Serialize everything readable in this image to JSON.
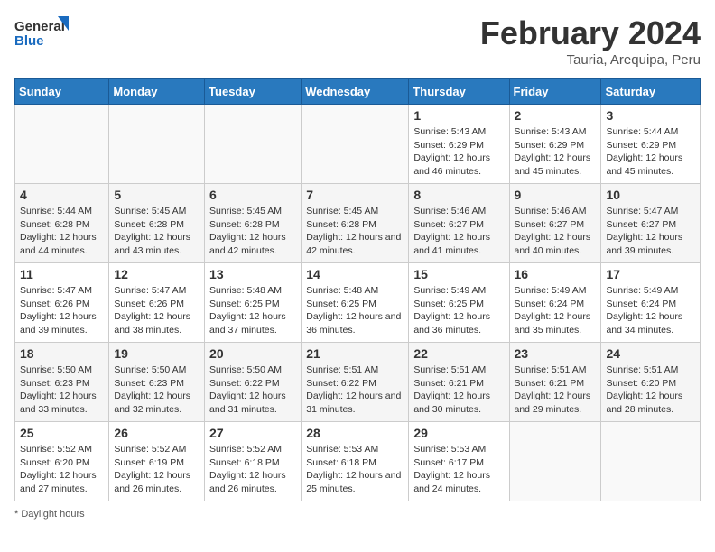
{
  "header": {
    "logo_general": "General",
    "logo_blue": "Blue",
    "main_title": "February 2024",
    "sub_title": "Tauria, Arequipa, Peru"
  },
  "days_of_week": [
    "Sunday",
    "Monday",
    "Tuesday",
    "Wednesday",
    "Thursday",
    "Friday",
    "Saturday"
  ],
  "weeks": [
    [
      {
        "day": "",
        "info": ""
      },
      {
        "day": "",
        "info": ""
      },
      {
        "day": "",
        "info": ""
      },
      {
        "day": "",
        "info": ""
      },
      {
        "day": "1",
        "info": "Sunrise: 5:43 AM\nSunset: 6:29 PM\nDaylight: 12 hours and 46 minutes."
      },
      {
        "day": "2",
        "info": "Sunrise: 5:43 AM\nSunset: 6:29 PM\nDaylight: 12 hours and 45 minutes."
      },
      {
        "day": "3",
        "info": "Sunrise: 5:44 AM\nSunset: 6:29 PM\nDaylight: 12 hours and 45 minutes."
      }
    ],
    [
      {
        "day": "4",
        "info": "Sunrise: 5:44 AM\nSunset: 6:28 PM\nDaylight: 12 hours and 44 minutes."
      },
      {
        "day": "5",
        "info": "Sunrise: 5:45 AM\nSunset: 6:28 PM\nDaylight: 12 hours and 43 minutes."
      },
      {
        "day": "6",
        "info": "Sunrise: 5:45 AM\nSunset: 6:28 PM\nDaylight: 12 hours and 42 minutes."
      },
      {
        "day": "7",
        "info": "Sunrise: 5:45 AM\nSunset: 6:28 PM\nDaylight: 12 hours and 42 minutes."
      },
      {
        "day": "8",
        "info": "Sunrise: 5:46 AM\nSunset: 6:27 PM\nDaylight: 12 hours and 41 minutes."
      },
      {
        "day": "9",
        "info": "Sunrise: 5:46 AM\nSunset: 6:27 PM\nDaylight: 12 hours and 40 minutes."
      },
      {
        "day": "10",
        "info": "Sunrise: 5:47 AM\nSunset: 6:27 PM\nDaylight: 12 hours and 39 minutes."
      }
    ],
    [
      {
        "day": "11",
        "info": "Sunrise: 5:47 AM\nSunset: 6:26 PM\nDaylight: 12 hours and 39 minutes."
      },
      {
        "day": "12",
        "info": "Sunrise: 5:47 AM\nSunset: 6:26 PM\nDaylight: 12 hours and 38 minutes."
      },
      {
        "day": "13",
        "info": "Sunrise: 5:48 AM\nSunset: 6:25 PM\nDaylight: 12 hours and 37 minutes."
      },
      {
        "day": "14",
        "info": "Sunrise: 5:48 AM\nSunset: 6:25 PM\nDaylight: 12 hours and 36 minutes."
      },
      {
        "day": "15",
        "info": "Sunrise: 5:49 AM\nSunset: 6:25 PM\nDaylight: 12 hours and 36 minutes."
      },
      {
        "day": "16",
        "info": "Sunrise: 5:49 AM\nSunset: 6:24 PM\nDaylight: 12 hours and 35 minutes."
      },
      {
        "day": "17",
        "info": "Sunrise: 5:49 AM\nSunset: 6:24 PM\nDaylight: 12 hours and 34 minutes."
      }
    ],
    [
      {
        "day": "18",
        "info": "Sunrise: 5:50 AM\nSunset: 6:23 PM\nDaylight: 12 hours and 33 minutes."
      },
      {
        "day": "19",
        "info": "Sunrise: 5:50 AM\nSunset: 6:23 PM\nDaylight: 12 hours and 32 minutes."
      },
      {
        "day": "20",
        "info": "Sunrise: 5:50 AM\nSunset: 6:22 PM\nDaylight: 12 hours and 31 minutes."
      },
      {
        "day": "21",
        "info": "Sunrise: 5:51 AM\nSunset: 6:22 PM\nDaylight: 12 hours and 31 minutes."
      },
      {
        "day": "22",
        "info": "Sunrise: 5:51 AM\nSunset: 6:21 PM\nDaylight: 12 hours and 30 minutes."
      },
      {
        "day": "23",
        "info": "Sunrise: 5:51 AM\nSunset: 6:21 PM\nDaylight: 12 hours and 29 minutes."
      },
      {
        "day": "24",
        "info": "Sunrise: 5:51 AM\nSunset: 6:20 PM\nDaylight: 12 hours and 28 minutes."
      }
    ],
    [
      {
        "day": "25",
        "info": "Sunrise: 5:52 AM\nSunset: 6:20 PM\nDaylight: 12 hours and 27 minutes."
      },
      {
        "day": "26",
        "info": "Sunrise: 5:52 AM\nSunset: 6:19 PM\nDaylight: 12 hours and 26 minutes."
      },
      {
        "day": "27",
        "info": "Sunrise: 5:52 AM\nSunset: 6:18 PM\nDaylight: 12 hours and 26 minutes."
      },
      {
        "day": "28",
        "info": "Sunrise: 5:53 AM\nSunset: 6:18 PM\nDaylight: 12 hours and 25 minutes."
      },
      {
        "day": "29",
        "info": "Sunrise: 5:53 AM\nSunset: 6:17 PM\nDaylight: 12 hours and 24 minutes."
      },
      {
        "day": "",
        "info": ""
      },
      {
        "day": "",
        "info": ""
      }
    ]
  ],
  "footer": {
    "note": "Daylight hours"
  }
}
